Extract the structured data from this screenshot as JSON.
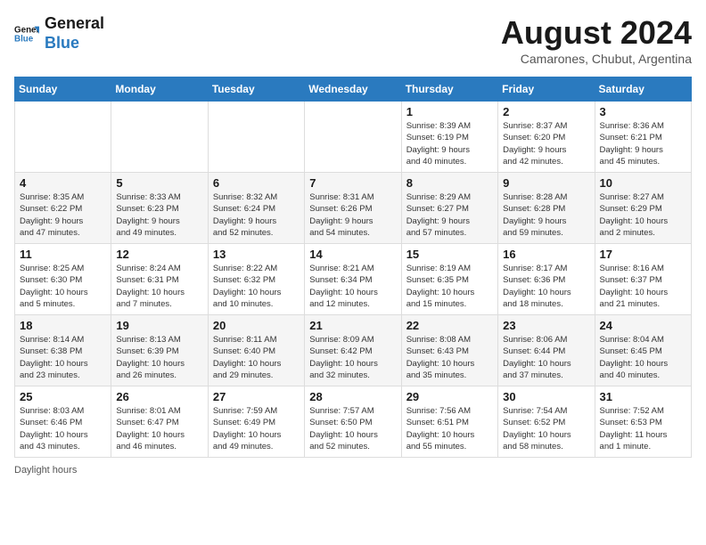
{
  "logo": {
    "line1": "General",
    "line2": "Blue"
  },
  "title": "August 2024",
  "subtitle": "Camarones, Chubut, Argentina",
  "days_of_week": [
    "Sunday",
    "Monday",
    "Tuesday",
    "Wednesday",
    "Thursday",
    "Friday",
    "Saturday"
  ],
  "weeks": [
    [
      {
        "date": "",
        "info": ""
      },
      {
        "date": "",
        "info": ""
      },
      {
        "date": "",
        "info": ""
      },
      {
        "date": "",
        "info": ""
      },
      {
        "date": "1",
        "info": "Sunrise: 8:39 AM\nSunset: 6:19 PM\nDaylight: 9 hours\nand 40 minutes."
      },
      {
        "date": "2",
        "info": "Sunrise: 8:37 AM\nSunset: 6:20 PM\nDaylight: 9 hours\nand 42 minutes."
      },
      {
        "date": "3",
        "info": "Sunrise: 8:36 AM\nSunset: 6:21 PM\nDaylight: 9 hours\nand 45 minutes."
      }
    ],
    [
      {
        "date": "4",
        "info": "Sunrise: 8:35 AM\nSunset: 6:22 PM\nDaylight: 9 hours\nand 47 minutes."
      },
      {
        "date": "5",
        "info": "Sunrise: 8:33 AM\nSunset: 6:23 PM\nDaylight: 9 hours\nand 49 minutes."
      },
      {
        "date": "6",
        "info": "Sunrise: 8:32 AM\nSunset: 6:24 PM\nDaylight: 9 hours\nand 52 minutes."
      },
      {
        "date": "7",
        "info": "Sunrise: 8:31 AM\nSunset: 6:26 PM\nDaylight: 9 hours\nand 54 minutes."
      },
      {
        "date": "8",
        "info": "Sunrise: 8:29 AM\nSunset: 6:27 PM\nDaylight: 9 hours\nand 57 minutes."
      },
      {
        "date": "9",
        "info": "Sunrise: 8:28 AM\nSunset: 6:28 PM\nDaylight: 9 hours\nand 59 minutes."
      },
      {
        "date": "10",
        "info": "Sunrise: 8:27 AM\nSunset: 6:29 PM\nDaylight: 10 hours\nand 2 minutes."
      }
    ],
    [
      {
        "date": "11",
        "info": "Sunrise: 8:25 AM\nSunset: 6:30 PM\nDaylight: 10 hours\nand 5 minutes."
      },
      {
        "date": "12",
        "info": "Sunrise: 8:24 AM\nSunset: 6:31 PM\nDaylight: 10 hours\nand 7 minutes."
      },
      {
        "date": "13",
        "info": "Sunrise: 8:22 AM\nSunset: 6:32 PM\nDaylight: 10 hours\nand 10 minutes."
      },
      {
        "date": "14",
        "info": "Sunrise: 8:21 AM\nSunset: 6:34 PM\nDaylight: 10 hours\nand 12 minutes."
      },
      {
        "date": "15",
        "info": "Sunrise: 8:19 AM\nSunset: 6:35 PM\nDaylight: 10 hours\nand 15 minutes."
      },
      {
        "date": "16",
        "info": "Sunrise: 8:17 AM\nSunset: 6:36 PM\nDaylight: 10 hours\nand 18 minutes."
      },
      {
        "date": "17",
        "info": "Sunrise: 8:16 AM\nSunset: 6:37 PM\nDaylight: 10 hours\nand 21 minutes."
      }
    ],
    [
      {
        "date": "18",
        "info": "Sunrise: 8:14 AM\nSunset: 6:38 PM\nDaylight: 10 hours\nand 23 minutes."
      },
      {
        "date": "19",
        "info": "Sunrise: 8:13 AM\nSunset: 6:39 PM\nDaylight: 10 hours\nand 26 minutes."
      },
      {
        "date": "20",
        "info": "Sunrise: 8:11 AM\nSunset: 6:40 PM\nDaylight: 10 hours\nand 29 minutes."
      },
      {
        "date": "21",
        "info": "Sunrise: 8:09 AM\nSunset: 6:42 PM\nDaylight: 10 hours\nand 32 minutes."
      },
      {
        "date": "22",
        "info": "Sunrise: 8:08 AM\nSunset: 6:43 PM\nDaylight: 10 hours\nand 35 minutes."
      },
      {
        "date": "23",
        "info": "Sunrise: 8:06 AM\nSunset: 6:44 PM\nDaylight: 10 hours\nand 37 minutes."
      },
      {
        "date": "24",
        "info": "Sunrise: 8:04 AM\nSunset: 6:45 PM\nDaylight: 10 hours\nand 40 minutes."
      }
    ],
    [
      {
        "date": "25",
        "info": "Sunrise: 8:03 AM\nSunset: 6:46 PM\nDaylight: 10 hours\nand 43 minutes."
      },
      {
        "date": "26",
        "info": "Sunrise: 8:01 AM\nSunset: 6:47 PM\nDaylight: 10 hours\nand 46 minutes."
      },
      {
        "date": "27",
        "info": "Sunrise: 7:59 AM\nSunset: 6:49 PM\nDaylight: 10 hours\nand 49 minutes."
      },
      {
        "date": "28",
        "info": "Sunrise: 7:57 AM\nSunset: 6:50 PM\nDaylight: 10 hours\nand 52 minutes."
      },
      {
        "date": "29",
        "info": "Sunrise: 7:56 AM\nSunset: 6:51 PM\nDaylight: 10 hours\nand 55 minutes."
      },
      {
        "date": "30",
        "info": "Sunrise: 7:54 AM\nSunset: 6:52 PM\nDaylight: 10 hours\nand 58 minutes."
      },
      {
        "date": "31",
        "info": "Sunrise: 7:52 AM\nSunset: 6:53 PM\nDaylight: 11 hours\nand 1 minute."
      }
    ]
  ],
  "footer": "Daylight hours"
}
